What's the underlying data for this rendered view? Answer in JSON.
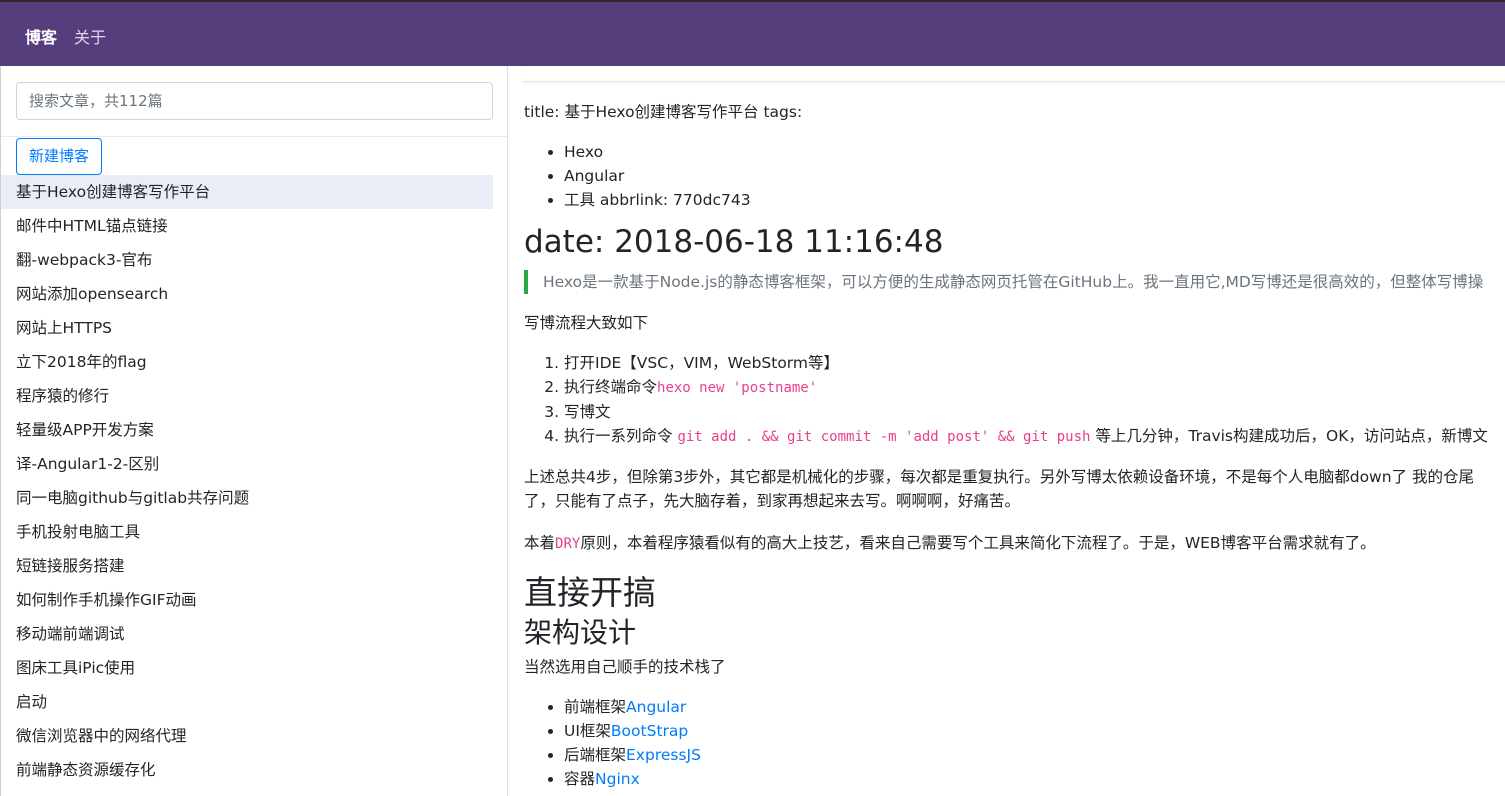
{
  "nav": {
    "brand": "博客",
    "about": "关于"
  },
  "sidebar": {
    "search_placeholder": "搜索文章，共112篇",
    "new_button": "新建博客",
    "posts": [
      "基于Hexo创建博客写作平台",
      "邮件中HTML锚点链接",
      "翻-webpack3-官布",
      "网站添加opensearch",
      "网站上HTTPS",
      "立下2018年的flag",
      "程序猿的修行",
      "轻量级APP开发方案",
      "译-Angular1-2-区别",
      "同一电脑github与gitlab共存问题",
      "手机投射电脑工具",
      "短链接服务搭建",
      "如何制作手机操作GIF动画",
      "移动端前端调试",
      "图床工具iPic使用",
      "启动",
      "微信浏览器中的网络代理",
      "前端静态资源缓存化"
    ]
  },
  "article": {
    "meta_line": "title: 基于Hexo创建博客写作平台 tags:",
    "tags": [
      "Hexo",
      "Angular",
      "工具 abbrlink: 770dc743"
    ],
    "date_heading": "date: 2018-06-18 11:16:48",
    "quote": "Hexo是一款基于Node.js的静态博客框架，可以方便的生成静态网页托管在GitHub上。我一直用它,MD写博还是很高效的，但整体写博操",
    "flow_intro": "写博流程大致如下",
    "steps": [
      {
        "text": "打开IDE【VSC，VIM，WebStorm等】",
        "code": "",
        "after": ""
      },
      {
        "text": "执行终端命令",
        "code": "hexo new 'postname'",
        "after": ""
      },
      {
        "text": "写博文",
        "code": "",
        "after": ""
      },
      {
        "text": "执行一系列命令 ",
        "code": "git add . && git commit -m 'add post' && git push",
        "after": " 等上几分钟，Travis构建成功后，OK，访问站点，新博文"
      }
    ],
    "para1_line1": "上述总共4步，但除第3步外，其它都是机械化的步骤，每次都是重复执行。另外写博太依赖设备环境，不是每个人电脑都down了 我的仓尾",
    "para1_line2": "了，只能有了点子，先大脑存着，到家再想起来去写。啊啊啊，好痛苦。",
    "para2_pre": "本着",
    "para2_code": "DRY",
    "para2_post": "原则，本着程序猿看似有的高大上技艺，看来自己需要写个工具来简化下流程了。于是，WEB博客平台需求就有了。",
    "h1": "直接开搞",
    "h2": "架构设计",
    "stack_intro": "当然选用自己顺手的技术栈了",
    "stack": [
      {
        "label": "前端框架",
        "link": "Angular"
      },
      {
        "label": "UI框架",
        "link": "BootStrap"
      },
      {
        "label": "后端框架",
        "link": "ExpressJS"
      },
      {
        "label": "容器",
        "link": "Nginx"
      }
    ]
  },
  "colors": {
    "navbar": "#563d7c",
    "accent": "#007bff",
    "quote_border": "#28a745",
    "code": "#e83e8c"
  }
}
